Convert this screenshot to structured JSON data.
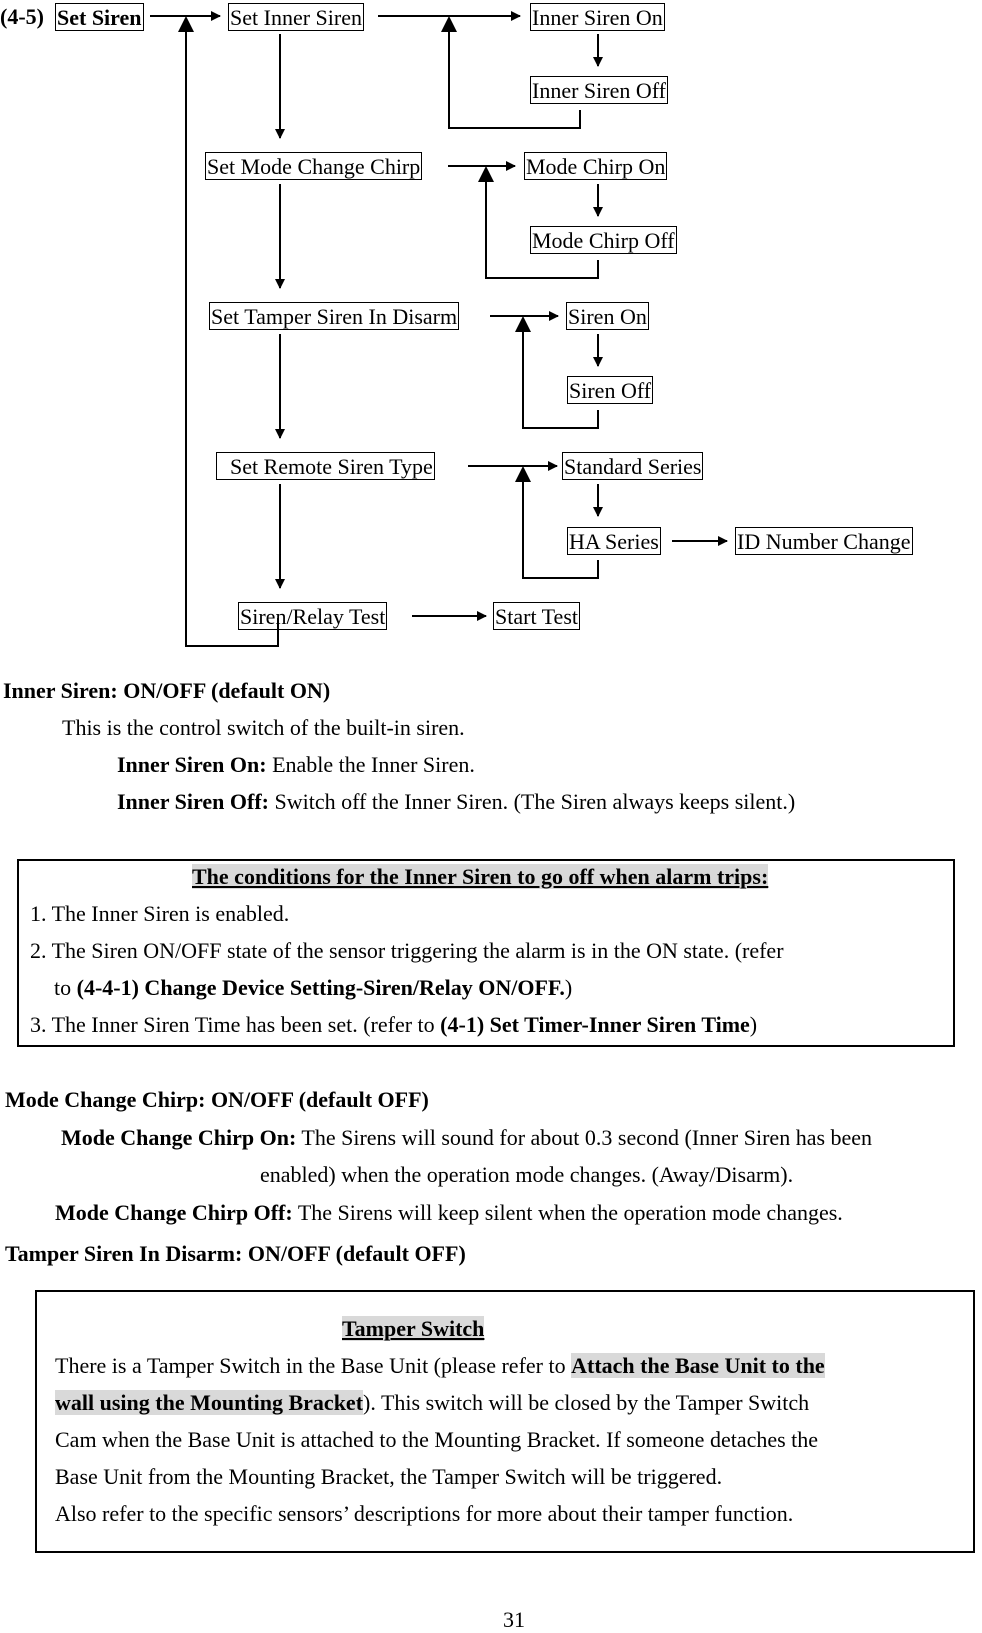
{
  "section_label": "(4-5)",
  "diagram": {
    "root": "Set Siren",
    "nodes": {
      "set_inner_siren": "Set Inner Siren",
      "inner_siren_on": "Inner Siren On",
      "inner_siren_off": "Inner Siren Off",
      "set_mode_change_chirp": "Set Mode Change Chirp",
      "mode_chirp_on": "Mode Chirp On",
      "mode_chirp_off": "Mode Chirp Off",
      "set_tamper_siren": "Set Tamper Siren In Disarm",
      "siren_on": "Siren On",
      "siren_off": "Siren Off",
      "set_remote_siren_type": "Set Remote Siren Type",
      "standard_series": "Standard Series",
      "ha_series": "HA Series",
      "id_number_change": "ID Number Change",
      "siren_relay_test": "Siren/Relay Test",
      "start_test": "Start Test"
    }
  },
  "inner_siren": {
    "heading": "Inner Siren: ON/OFF (default ON)",
    "desc": "This is the control switch of the built-in siren.",
    "on_label": "Inner Siren On:",
    "on_text": " Enable the Inner Siren.",
    "off_label": "Inner Siren Off:",
    "off_text": " Switch off the Inner Siren. (The Siren always keeps silent.)"
  },
  "conditions_box": {
    "title": "The conditions for the Inner Siren to go off when alarm trips:",
    "item1": "1. The Inner Siren is enabled.",
    "item2_a": "2. The Siren ON/OFF state of the sensor triggering the alarm is in the ON state. (refer",
    "item2_b_pre": "to ",
    "item2_b_bold": "(4-4-1) Change Device Setting-Siren/Relay ON/OFF.",
    "item2_b_post": ")",
    "item3_pre": "3. The Inner Siren Time has been set. (refer to ",
    "item3_bold": "(4-1) Set Timer-Inner Siren Time",
    "item3_post": ")"
  },
  "mode_chirp": {
    "heading": "Mode Change Chirp: ON/OFF (default OFF)",
    "on_label": "Mode Change Chirp On:",
    "on_text_1": " The Sirens will sound for about 0.3 second (Inner Siren has been",
    "on_text_2": "enabled) when the operation mode changes. (Away/Disarm).",
    "off_label": "Mode Change Chirp Off:",
    "off_text": " The Sirens will keep silent when the operation mode changes."
  },
  "tamper": {
    "heading": "Tamper Siren In Disarm: ON/OFF (default OFF)",
    "box_title": "Tamper Switch",
    "line1_pre": "There is a Tamper Switch in the Base Unit (please refer to ",
    "line1_bold": "Attach the Base Unit to the",
    "line2_bold": "wall using the Mounting Bracket",
    "line2_post": "). This switch will be closed by the Tamper Switch",
    "line3": "Cam when the Base Unit is attached to the Mounting Bracket. If someone detaches the",
    "line4": "Base Unit from the Mounting Bracket, the Tamper Switch will be triggered.",
    "line5": "Also refer to the specific sensors’ descriptions for more about their tamper function."
  },
  "page_number": "31"
}
